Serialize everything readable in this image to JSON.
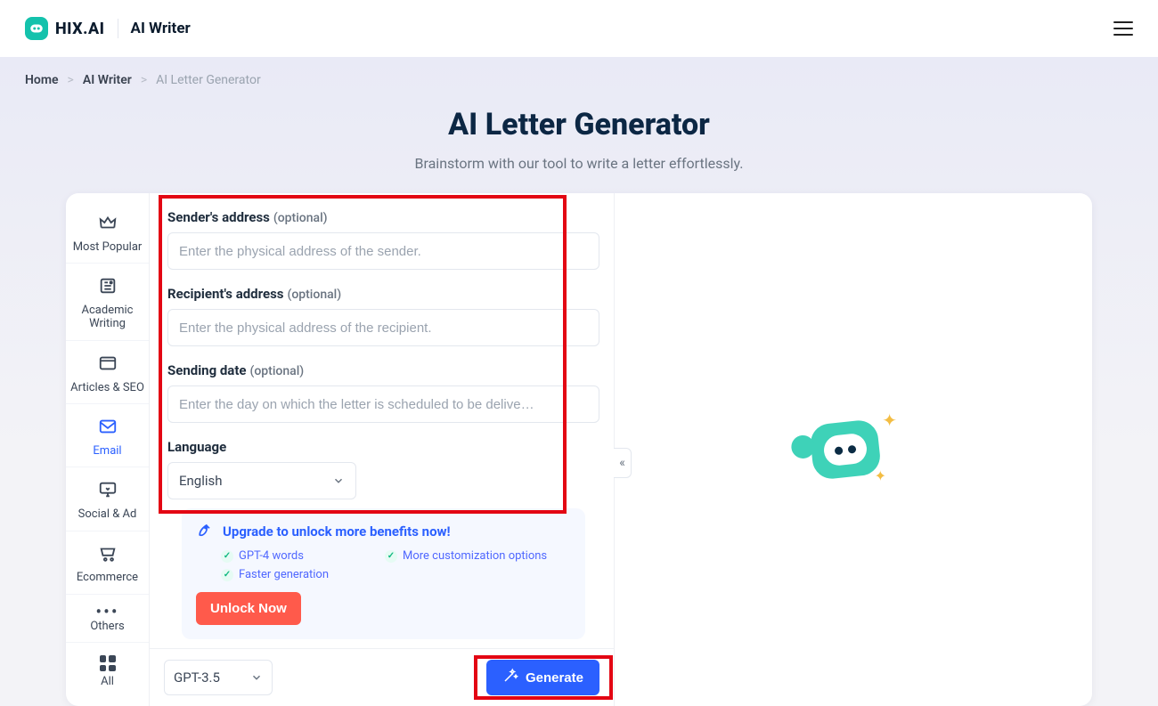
{
  "header": {
    "brand": "HIX.AI",
    "app": "AI Writer"
  },
  "breadcrumb": {
    "home": "Home",
    "mid": "AI Writer",
    "current": "AI Letter Generator"
  },
  "page": {
    "title": "AI Letter Generator",
    "subtitle": "Brainstorm with our tool to write a letter effortlessly."
  },
  "sidebar": {
    "items": [
      {
        "label": "Most Popular"
      },
      {
        "label": "Academic Writing"
      },
      {
        "label": "Articles & SEO"
      },
      {
        "label": "Email"
      },
      {
        "label": "Social & Ad"
      },
      {
        "label": "Ecommerce"
      },
      {
        "label": "Others"
      },
      {
        "label": "All"
      }
    ]
  },
  "form": {
    "sender_label": "Sender's address",
    "sender_opt": "(optional)",
    "sender_placeholder": "Enter the physical address of the sender.",
    "recipient_label": "Recipient's address",
    "recipient_opt": "(optional)",
    "recipient_placeholder": "Enter the physical address of the recipient.",
    "date_label": "Sending date",
    "date_opt": "(optional)",
    "date_placeholder": "Enter the day on which the letter is scheduled to be delive…",
    "language_label": "Language",
    "language_value": "English"
  },
  "promo": {
    "title": "Upgrade to unlock more benefits now!",
    "feat1": "GPT-4 words",
    "feat2": "More customization options",
    "feat3": "Faster generation",
    "cta": "Unlock Now"
  },
  "footer": {
    "model_value": "GPT-3.5",
    "generate": "Generate"
  },
  "collapse_glyph": "«"
}
